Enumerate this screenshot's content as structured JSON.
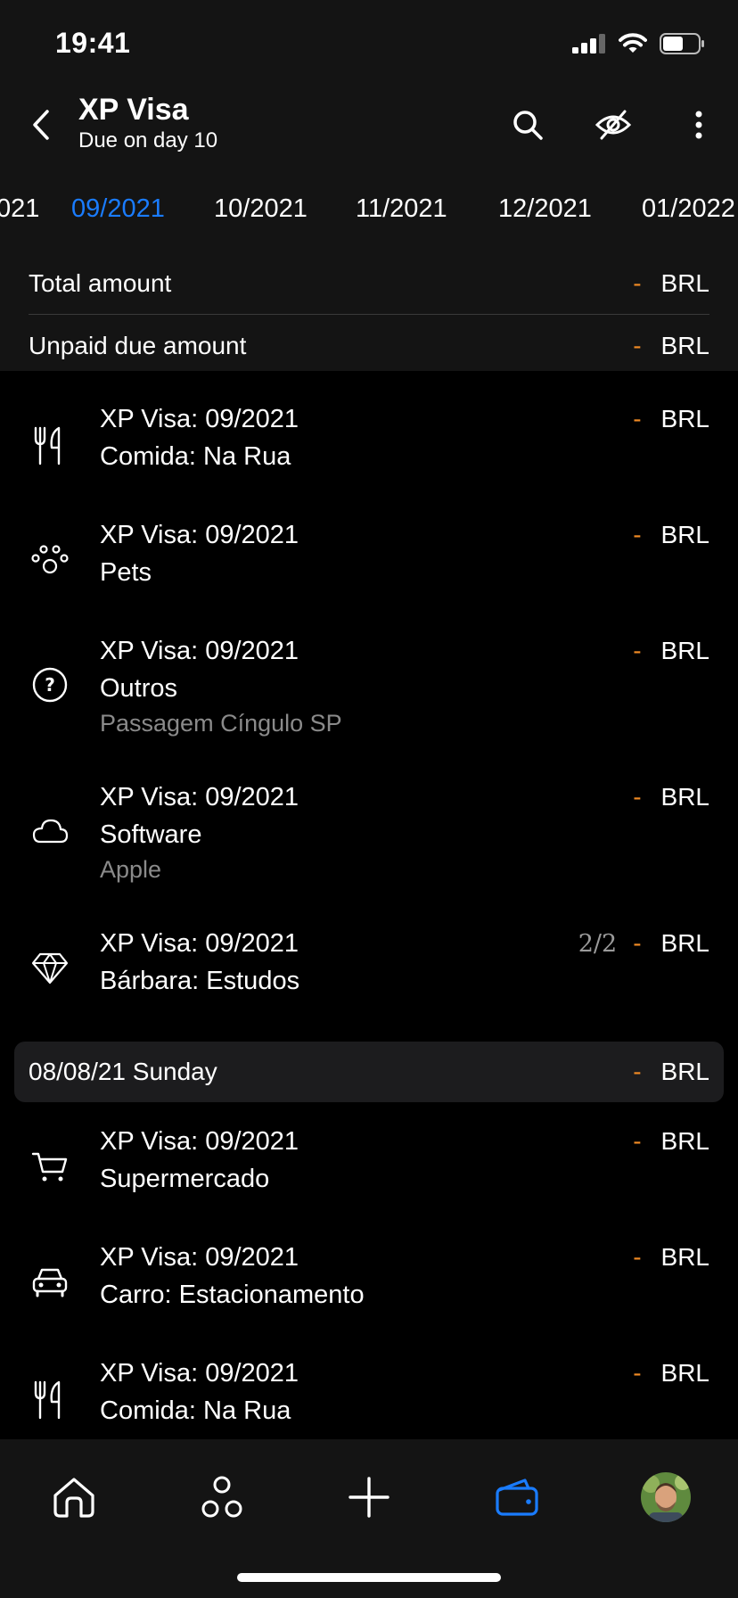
{
  "status": {
    "time": "19:41"
  },
  "header": {
    "title": "XP Visa",
    "subtitle": "Due on day 10"
  },
  "months": [
    "021",
    "09/2021",
    "10/2021",
    "11/2021",
    "12/2021",
    "01/2022"
  ],
  "active_month": "09/2021",
  "summary": {
    "total_label": "Total amount",
    "total_value": "-",
    "total_currency": "BRL",
    "unpaid_label": "Unpaid due amount",
    "unpaid_value": "-",
    "unpaid_currency": "BRL"
  },
  "transactions": [
    {
      "icon": "utensils-icon",
      "line1": "XP Visa: 09/2021",
      "line2": "Comida: Na Rua",
      "line3": "",
      "installment": "",
      "value": "-",
      "currency": "BRL"
    },
    {
      "icon": "paw-icon",
      "line1": "XP Visa: 09/2021",
      "line2": "Pets",
      "line3": "",
      "installment": "",
      "value": "-",
      "currency": "BRL"
    },
    {
      "icon": "question-circle-icon",
      "line1": "XP Visa: 09/2021",
      "line2": "Outros",
      "line3": "Passagem Cíngulo SP",
      "installment": "",
      "value": "-",
      "currency": "BRL"
    },
    {
      "icon": "cloud-icon",
      "line1": "XP Visa: 09/2021",
      "line2": "Software",
      "line3": "Apple",
      "installment": "",
      "value": "-",
      "currency": "BRL"
    },
    {
      "icon": "diamond-icon",
      "line1": "XP Visa: 09/2021",
      "line2": "Bárbara: Estudos",
      "line3": "",
      "installment": "2/2",
      "value": "-",
      "currency": "BRL"
    },
    {
      "icon": "cart-icon",
      "line1": "XP Visa: 09/2021",
      "line2": "Supermercado",
      "line3": "",
      "installment": "",
      "value": "-",
      "currency": "BRL"
    },
    {
      "icon": "car-icon",
      "line1": "XP Visa: 09/2021",
      "line2": "Carro: Estacionamento",
      "line3": "",
      "installment": "",
      "value": "-",
      "currency": "BRL"
    },
    {
      "icon": "utensils-icon",
      "line1": "XP Visa: 09/2021",
      "line2": "Comida: Na Rua",
      "line3": "",
      "installment": "",
      "value": "-",
      "currency": "BRL"
    }
  ],
  "date_header": {
    "label": "08/08/21 Sunday",
    "value": "-",
    "currency": "BRL"
  },
  "tabbar": [
    "home-icon",
    "categories-icon",
    "add-icon",
    "wallet-icon",
    "avatar"
  ],
  "colors": {
    "accent": "#1a7cff",
    "dash": "#f08a24",
    "background": "#000000",
    "panel": "#141414"
  }
}
